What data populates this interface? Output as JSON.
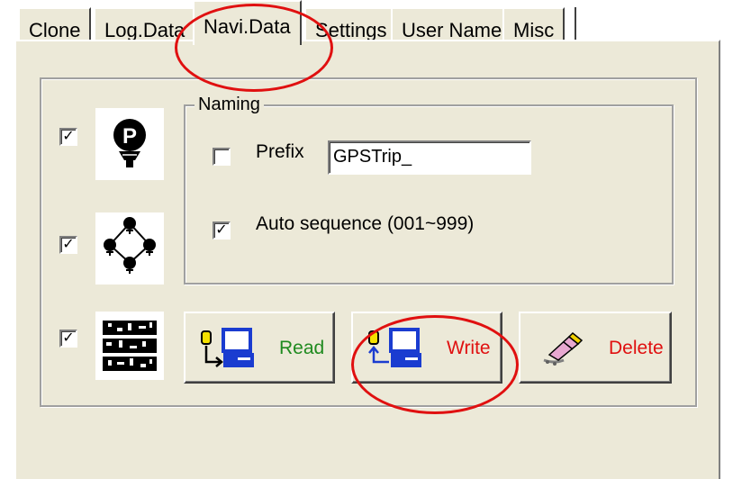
{
  "tabs": [
    {
      "label": "Clone"
    },
    {
      "label": "Log.Data"
    },
    {
      "label": "Navi.Data",
      "active": true
    },
    {
      "label": "Settings"
    },
    {
      "label": "User Name"
    },
    {
      "label": "Misc"
    }
  ],
  "naming": {
    "group_label": "Naming",
    "prefix": {
      "label": "Prefix",
      "checked": false,
      "value": "GPSTrip_"
    },
    "auto_sequence": {
      "label": "Auto sequence (001~999)",
      "checked": true
    }
  },
  "rows": [
    {
      "checked": true,
      "icon": "poi-icon"
    },
    {
      "checked": true,
      "icon": "route-icon"
    },
    {
      "checked": true,
      "icon": "track-icon"
    }
  ],
  "buttons": {
    "read": {
      "label": "Read",
      "color": "#1f8a1f"
    },
    "write": {
      "label": "Write",
      "color": "#e01010"
    },
    "delete": {
      "label": "Delete",
      "color": "#e01010"
    }
  },
  "check_mark": "✓",
  "colors": {
    "face": "#ece9d8",
    "annotation": "#e01010"
  }
}
